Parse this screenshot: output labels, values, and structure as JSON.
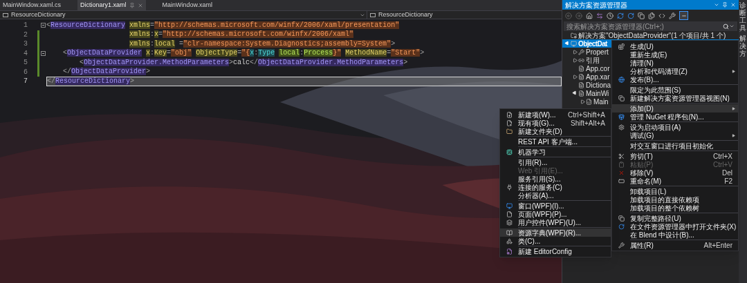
{
  "editor_tabs": [
    {
      "label": "MainWindow.xaml.cs",
      "selected": false
    },
    {
      "label": "Dictionary1.xaml",
      "selected": true
    },
    {
      "label": "MainWindow.xaml",
      "selected": false
    }
  ],
  "breadcrumb": {
    "left": "ResourceDictionary",
    "right": "ResourceDictionary"
  },
  "code": {
    "lines": [
      {
        "number": "1",
        "current": false,
        "changed": false,
        "foldable": true,
        "kind": "flush",
        "tokens": [
          {
            "kind": "punct",
            "text": "<"
          },
          {
            "kind": "tag",
            "text": "ResourceDictionary"
          },
          {
            "kind": "attr",
            "text": "xmlns",
            "gap": true
          },
          {
            "kind": "punct",
            "text": "="
          },
          {
            "kind": "string",
            "text": "\"http://schemas.microsoft.com/winfx/2006/xaml/presentation\""
          }
        ]
      },
      {
        "number": "2",
        "current": false,
        "changed": true,
        "foldable": false,
        "kind": "attrs",
        "tokens": [
          {
            "kind": "attr",
            "text": "xmlns"
          },
          {
            "kind": "punct",
            "text": ":"
          },
          {
            "kind": "attr",
            "text": "x"
          },
          {
            "kind": "punct",
            "text": "="
          },
          {
            "kind": "string",
            "text": "\"http://schemas.microsoft.com/winfx/2006/xaml\""
          }
        ]
      },
      {
        "number": "3",
        "current": false,
        "changed": true,
        "foldable": false,
        "kind": "attrs",
        "tokens": [
          {
            "kind": "attr",
            "text": "xmlns"
          },
          {
            "kind": "punct",
            "text": ":"
          },
          {
            "kind": "attr",
            "text": "local"
          },
          {
            "kind": "punct",
            "text": "=",
            "gap": true
          },
          {
            "kind": "string",
            "text": "\"clr-namespace:System.Diagnostics;assembly=System\""
          },
          {
            "kind": "punct",
            "text": ">"
          }
        ]
      },
      {
        "number": "4",
        "current": false,
        "changed": true,
        "foldable": true,
        "kind": "nested",
        "tokens": [
          {
            "kind": "punct",
            "text": "<"
          },
          {
            "kind": "tag",
            "text": "ObjectDataProvider"
          },
          {
            "kind": "attr",
            "text": "x",
            "gap": true
          },
          {
            "kind": "punct",
            "text": ":"
          },
          {
            "kind": "attr",
            "text": "Key"
          },
          {
            "kind": "punct",
            "text": "="
          },
          {
            "kind": "string",
            "text": "\"obj\""
          },
          {
            "kind": "attr",
            "text": "ObjectType",
            "gap": true
          },
          {
            "kind": "punct",
            "text": "="
          },
          {
            "kind": "string",
            "text": "\"{"
          },
          {
            "kind": "ns",
            "text": "x"
          },
          {
            "kind": "punct",
            "text": ":"
          },
          {
            "kind": "ns",
            "text": "Type"
          },
          {
            "kind": "typeref",
            "text": "local",
            "gap": true
          },
          {
            "kind": "punct",
            "text": ":"
          },
          {
            "kind": "typeref",
            "text": "Process"
          },
          {
            "kind": "string",
            "text": "}\""
          },
          {
            "kind": "attr",
            "text": "MethodName",
            "gap": true
          },
          {
            "kind": "punct",
            "text": "="
          },
          {
            "kind": "string",
            "text": "\"Start\""
          },
          {
            "kind": "punct",
            "text": ">"
          }
        ]
      },
      {
        "number": "5",
        "current": false,
        "changed": true,
        "foldable": false,
        "kind": "nested2",
        "tokens": [
          {
            "kind": "punct",
            "text": "<"
          },
          {
            "kind": "tag",
            "text": "ObjectDataProvider.MethodParameters"
          },
          {
            "kind": "punct",
            "text": ">"
          },
          {
            "kind": "text",
            "text": "calc"
          },
          {
            "kind": "punct",
            "text": "</"
          },
          {
            "kind": "tag",
            "text": "ObjectDataProvider.MethodParameters"
          },
          {
            "kind": "punct",
            "text": ">"
          }
        ]
      },
      {
        "number": "6",
        "current": false,
        "changed": true,
        "foldable": false,
        "kind": "nested",
        "tokens": [
          {
            "kind": "punct",
            "text": "</"
          },
          {
            "kind": "tag",
            "text": "ObjectDataProvider"
          },
          {
            "kind": "punct",
            "text": ">"
          }
        ]
      },
      {
        "number": "7",
        "current": true,
        "changed": false,
        "foldable": false,
        "kind": "flush",
        "tokens": [
          {
            "kind": "punct",
            "text": "</"
          },
          {
            "kind": "tag",
            "text": "ResourceDictionary"
          },
          {
            "kind": "punct",
            "text": ">"
          }
        ]
      }
    ]
  },
  "solution_explorer": {
    "title": "解决方案资源管理器",
    "search": {
      "placeholder": "搜索解决方案资源管理器(Ctrl+;)"
    },
    "tree": [
      {
        "label": "解决方案\"ObjectDataProvider\"(1 个项目/共 1 个)",
        "kind": "solution",
        "selected": false,
        "children": [
          {
            "label": "ObjectDat",
            "kind": "project",
            "selected": true,
            "expanded": true,
            "children": [
              {
                "label": "Propert",
                "kind": "properties",
                "selected": false,
                "expanded": false
              },
              {
                "label": "引用",
                "kind": "references",
                "selected": false,
                "expanded": false
              },
              {
                "label": "App.cor",
                "kind": "file",
                "selected": false
              },
              {
                "label": "App.xar",
                "kind": "file",
                "selected": false,
                "expanded": false
              },
              {
                "label": "Dictiona",
                "kind": "file",
                "selected": false
              },
              {
                "label": "MainWi",
                "kind": "file",
                "selected": false,
                "expanded": true,
                "children": [
                  {
                    "label": "Main",
                    "kind": "code",
                    "selected": false,
                    "expanded": false
                  }
                ]
              }
            ]
          }
        ]
      }
    ]
  },
  "side_tabs": [
    "诊断工具",
    "解决方"
  ],
  "context_menu": {
    "items": [
      {
        "kind": "item",
        "label": "生成(U)",
        "selected": false,
        "disabled": false,
        "submenu": false
      },
      {
        "kind": "item",
        "label": "重新生成(E)",
        "selected": false,
        "disabled": false,
        "submenu": false
      },
      {
        "kind": "item",
        "label": "清理(N)",
        "selected": false,
        "disabled": false,
        "submenu": false
      },
      {
        "kind": "item",
        "label": "分析和代码清理(Z)",
        "selected": false,
        "disabled": false,
        "submenu": true
      },
      {
        "kind": "item",
        "label": "发布(B)...",
        "selected": false,
        "disabled": false,
        "submenu": false
      },
      {
        "kind": "separator"
      },
      {
        "kind": "item",
        "label": "限定为此范围(S)",
        "selected": false,
        "disabled": false,
        "submenu": false
      },
      {
        "kind": "item",
        "label": "新建解决方案资源管理器视图(N)",
        "selected": false,
        "disabled": false,
        "submenu": false
      },
      {
        "kind": "separator"
      },
      {
        "kind": "item",
        "label": "添加(D)",
        "selected": true,
        "disabled": false,
        "submenu": true
      },
      {
        "kind": "item",
        "label": "管理 NuGet 程序包(N)...",
        "selected": false,
        "disabled": false,
        "submenu": false
      },
      {
        "kind": "separator"
      },
      {
        "kind": "item",
        "label": "设为启动项目(A)",
        "selected": false,
        "disabled": false,
        "submenu": false
      },
      {
        "kind": "item",
        "label": "调试(G)",
        "selected": false,
        "disabled": false,
        "submenu": true
      },
      {
        "kind": "separator"
      },
      {
        "kind": "item",
        "label": "对交互窗口进行项目初始化",
        "selected": false,
        "disabled": false,
        "submenu": false
      },
      {
        "kind": "separator"
      },
      {
        "kind": "item",
        "label": "剪切(T)",
        "shortcut": "Ctrl+X",
        "selected": false,
        "disabled": false,
        "submenu": false
      },
      {
        "kind": "item",
        "label": "粘贴(P)",
        "shortcut": "Ctrl+V",
        "selected": false,
        "disabled": true,
        "submenu": false
      },
      {
        "kind": "item",
        "label": "移除(V)",
        "shortcut": "Del",
        "selected": false,
        "disabled": false,
        "submenu": false
      },
      {
        "kind": "item",
        "label": "重命名(M)",
        "shortcut": "F2",
        "selected": false,
        "disabled": false,
        "submenu": false
      },
      {
        "kind": "separator"
      },
      {
        "kind": "item",
        "label": "卸载项目(L)",
        "selected": false,
        "disabled": false,
        "submenu": false
      },
      {
        "kind": "item",
        "label": "加载项目的直接依赖项",
        "selected": false,
        "disabled": false,
        "submenu": false
      },
      {
        "kind": "item",
        "label": "加载项目的整个依赖树",
        "selected": false,
        "disabled": false,
        "submenu": false
      },
      {
        "kind": "separator"
      },
      {
        "kind": "item",
        "label": "复制完整路径(U)",
        "selected": false,
        "disabled": false,
        "submenu": false
      },
      {
        "kind": "item",
        "label": "在文件资源管理器中打开文件夹(X)",
        "selected": false,
        "disabled": false,
        "submenu": false
      },
      {
        "kind": "item",
        "label": "在 Blend 中设计(B)...",
        "selected": false,
        "disabled": false,
        "submenu": false
      },
      {
        "kind": "separator"
      },
      {
        "kind": "item",
        "label": "属性(R)",
        "shortcut": "Alt+Enter",
        "selected": false,
        "disabled": false,
        "submenu": false
      }
    ]
  },
  "add_submenu": {
    "items": [
      {
        "kind": "item",
        "label": "新建项(W)...",
        "shortcut": "Ctrl+Shift+A",
        "selected": false,
        "disabled": false
      },
      {
        "kind": "item",
        "label": "现有项(G)...",
        "shortcut": "Shift+Alt+A",
        "selected": false,
        "disabled": false
      },
      {
        "kind": "item",
        "label": "新建文件夹(D)",
        "selected": false,
        "disabled": false
      },
      {
        "kind": "separator"
      },
      {
        "kind": "item",
        "label": "REST API 客户端...",
        "selected": false,
        "disabled": false
      },
      {
        "kind": "separator"
      },
      {
        "kind": "item",
        "label": "机器学习",
        "selected": false,
        "disabled": false
      },
      {
        "kind": "separator"
      },
      {
        "kind": "item",
        "label": "引用(R)...",
        "selected": false,
        "disabled": false
      },
      {
        "kind": "item",
        "label": "Web 引用(E)...",
        "selected": false,
        "disabled": true
      },
      {
        "kind": "item",
        "label": "服务引用(S)...",
        "selected": false,
        "disabled": false
      },
      {
        "kind": "item",
        "label": "连接的服务(C)",
        "selected": false,
        "disabled": false
      },
      {
        "kind": "item",
        "label": "分析器(A)...",
        "selected": false,
        "disabled": false
      },
      {
        "kind": "separator"
      },
      {
        "kind": "item",
        "label": "窗口(WPF)(I)...",
        "selected": false,
        "disabled": false
      },
      {
        "kind": "item",
        "label": "页面(WPF)(P)...",
        "selected": false,
        "disabled": false
      },
      {
        "kind": "item",
        "label": "用户控件(WPF)(U)...",
        "selected": false,
        "disabled": false
      },
      {
        "kind": "separator"
      },
      {
        "kind": "item",
        "label": "资源字典(WPF)(R)...",
        "selected": true,
        "disabled": false
      },
      {
        "kind": "item",
        "label": "类(C)...",
        "selected": false,
        "disabled": false
      },
      {
        "kind": "separator"
      },
      {
        "kind": "item",
        "label": "新建 EditorConfig",
        "selected": false,
        "disabled": false
      }
    ]
  }
}
